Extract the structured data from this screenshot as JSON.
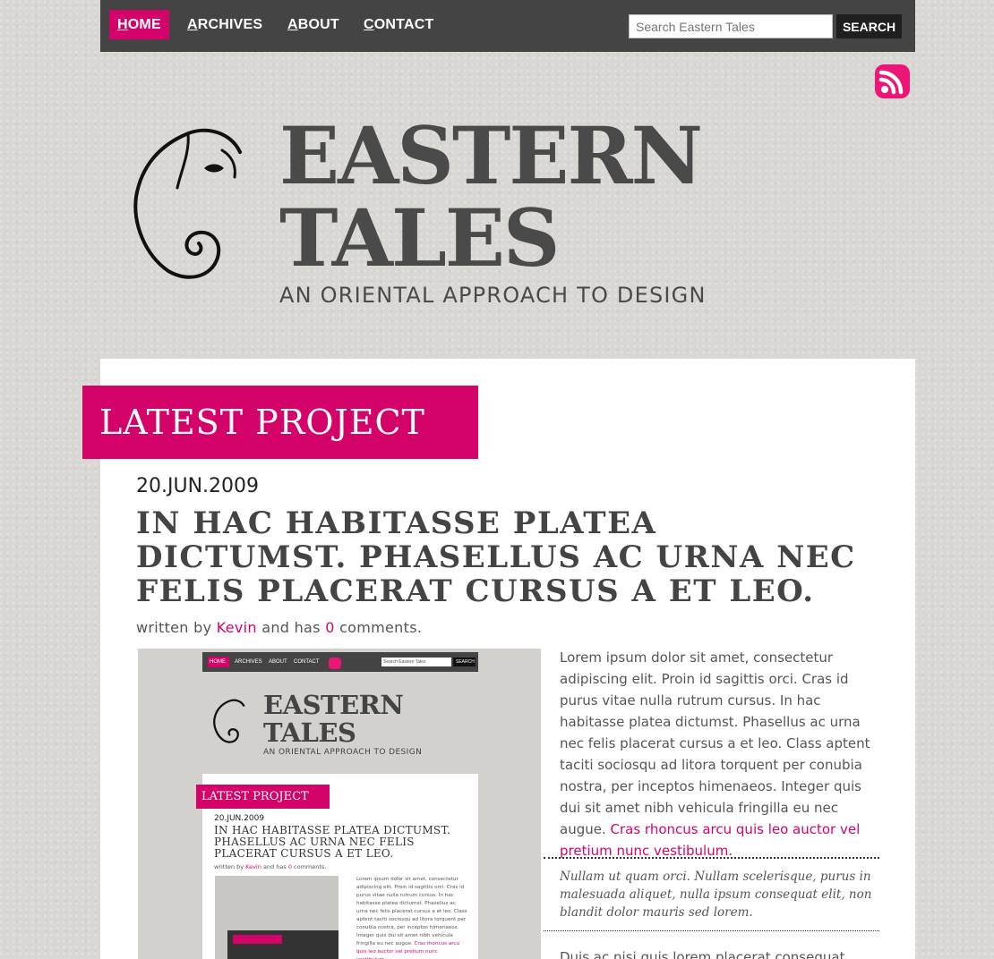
{
  "nav": {
    "items": [
      {
        "label": "HOME",
        "active": true
      },
      {
        "label": "ARCHIVES",
        "active": false
      },
      {
        "label": "ABOUT",
        "active": false
      },
      {
        "label": "CONTACT",
        "active": false
      }
    ]
  },
  "search": {
    "placeholder": "Search Eastern Tales",
    "value": "Search Eastern Tales",
    "button_label": "SEARCH"
  },
  "header": {
    "title_line1": "EASTERN",
    "title_line2": "TALES",
    "tagline": "AN ORIENTAL APPROACH TO DESIGN"
  },
  "section": {
    "badge": "LATEST PROJECT"
  },
  "post": {
    "date": "20.JUN.2009",
    "title": "IN HAC HABITASSE PLATEA DICTUMST. PHASELLUS AC URNA NEC FELIS PLACERAT CURSUS A ET LEO.",
    "meta_prefix": "written by",
    "author": "Kevin",
    "meta_middle": "and has",
    "comment_count": "0",
    "meta_suffix": "comments.",
    "body_plain": "Lorem ipsum dolor sit amet, consectetur adipiscing elit. Proin id sagittis orci. Cras id purus vitae nulla rutrum cursus. In hac habitasse platea dictumst. Phasellus ac urna nec felis placerat cursus a et leo. Class aptent taciti sociosqu ad litora torquent per conubia nostra, per inceptos himenaeos. Integer quis dui sit amet nibh vehicula fringilla eu nec augue.",
    "body_link": "Cras rhoncus arcu quis leo auctor vel pretium nunc vestibulum.",
    "quote": "Nullam ut quam orci. Nullam scelerisque, purus in malesuada aliquet, nulla ipsum consequat elit, non blandit dolor mauris sed lorem.",
    "body_2": "Duis ac nisi quis lorem placerat consequat"
  },
  "thumbnail": {
    "nav": [
      "HOME",
      "ARCHIVES",
      "ABOUT",
      "CONTACT"
    ],
    "search": "Search Eastern Tales",
    "search_button": "SEARCH",
    "title": "EASTERN TALES",
    "tagline": "AN ORIENTAL APPROACH TO DESIGN",
    "badge": "LATEST PROJECT",
    "date": "20.JUN.2009",
    "post_title": "IN HAC HABITASSE PLATEA DICTUMST. PHASELLUS AC URNA NEC FELIS PLACERAT CURSUS A ET LEO.",
    "meta_prefix": "written by",
    "author": "Kevin",
    "meta_middle": "and has",
    "comment_count": "0",
    "meta_suffix": "comments.",
    "body": "Lorem ipsum dolor sit amet, consectetur adipiscing elit. Proin id sagittis orci. Cras id purus vitae nulla rutrum cursus. In hac habitasse platea dictumst. Phasellus ac urna nec felis placerat cursus a et leo. Class aptent taciti sociosqu ad litora torquent per conubia nostra, per inceptos himenaeos. Integer quis dui sit amet nibh vehicula fringilla eu nec augue.",
    "body_link": "Cras rhoncus arcu quis leo auctor vel pretium nunc vestibulum."
  },
  "colors": {
    "accent": "#d4036a",
    "nav_bg": "#444444",
    "rss": "#ed1677"
  },
  "icons": {
    "rss": "rss-feed-icon",
    "logo": "elephant-logo-icon"
  }
}
